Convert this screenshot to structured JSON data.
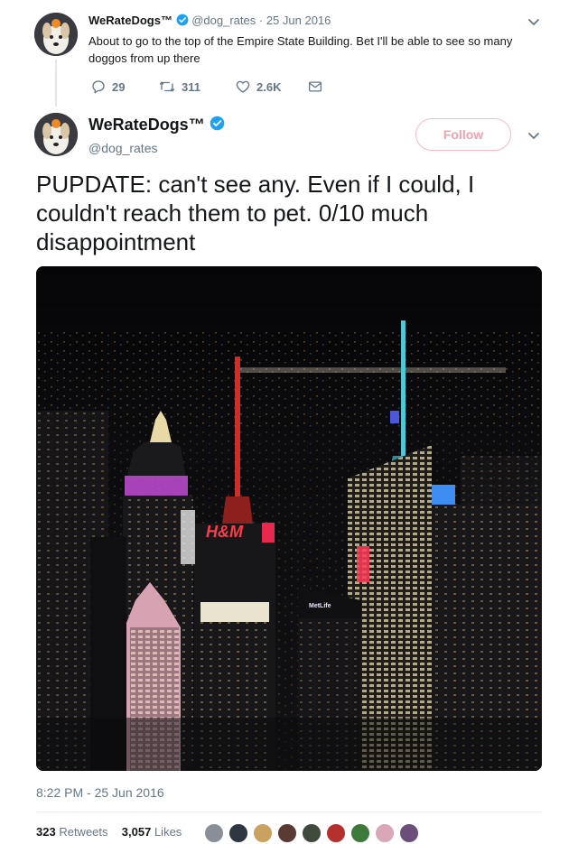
{
  "reply_tweet": {
    "name": "WeRateDogs™",
    "handle": "@dog_rates",
    "date": "25 Jun 2016",
    "text": "About to go to the top of the Empire State Building. Bet I'll be able to see so many doggos from up there",
    "replies": "29",
    "retweets": "311",
    "likes": "2.6K"
  },
  "main_tweet": {
    "name": "WeRateDogs™",
    "handle": "@dog_rates",
    "follow_label": "Follow",
    "text": "PUPDATE: can't see any. Even if I could, I couldn't reach them to pet. 0/10 much disappointment",
    "image_signs": [
      "H&M",
      "MetLife"
    ],
    "timestamp": "8:22 PM - 25 Jun 2016",
    "retweet_count": "323",
    "retweet_label": "Retweets",
    "like_count": "3,057",
    "like_label": "Likes"
  },
  "colors": {
    "brand_blue": "#1da1f2",
    "muted_text": "#657786",
    "follow_pink": "#f4a1ae"
  },
  "icons": [
    "verified-icon",
    "chevron-down-icon",
    "reply-icon",
    "retweet-icon",
    "like-icon",
    "dm-icon"
  ]
}
